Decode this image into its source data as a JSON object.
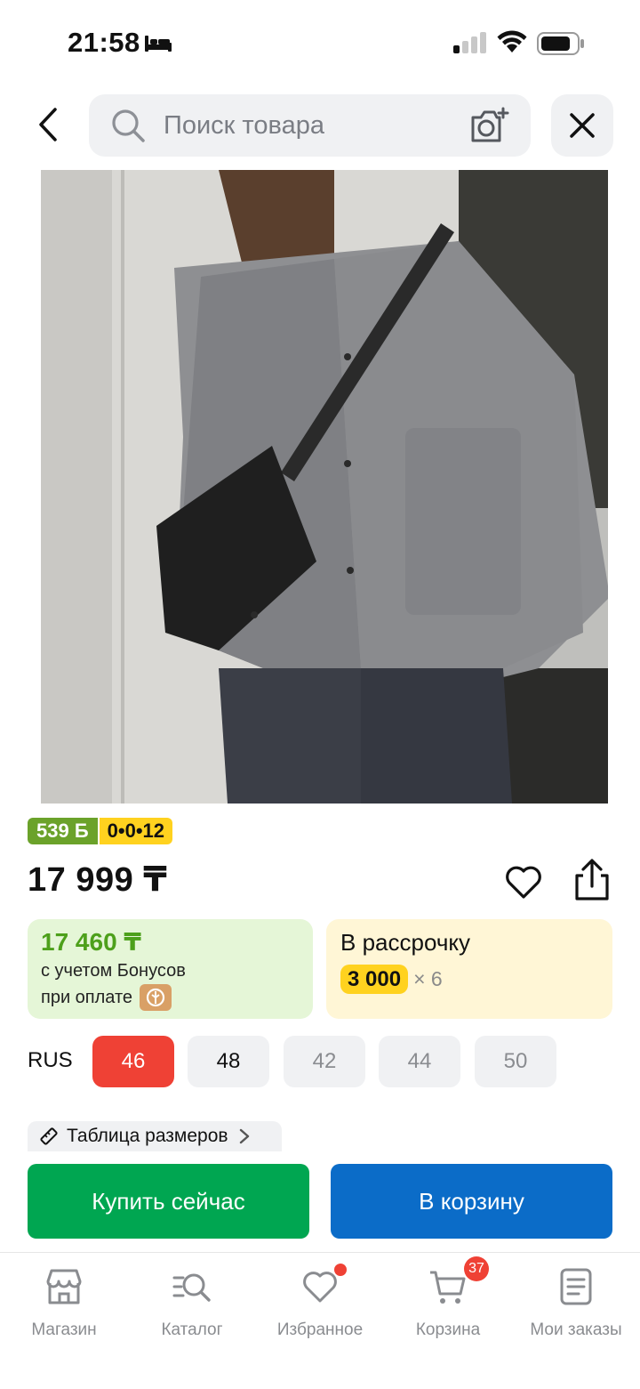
{
  "status_bar": {
    "time": "21:58"
  },
  "search": {
    "placeholder": "Поиск товара"
  },
  "badges": {
    "bonus": "539 Б",
    "installment": "0•0•12"
  },
  "product": {
    "price": "17 999 ₸"
  },
  "bonus_card": {
    "price": "17 460 ₸",
    "line1": "с учетом Бонусов",
    "line2": "при оплате"
  },
  "installment_card": {
    "title": "В рассрочку",
    "amount": "3 000",
    "multiplier": "× 6"
  },
  "sizes": {
    "system": "RUS",
    "options": [
      {
        "label": "46",
        "state": "selected"
      },
      {
        "label": "48",
        "state": "available"
      },
      {
        "label": "42",
        "state": "unavailable"
      },
      {
        "label": "44",
        "state": "unavailable"
      },
      {
        "label": "50",
        "state": "unavailable"
      }
    ]
  },
  "size_chart": {
    "label": "Таблица размеров"
  },
  "actions": {
    "buy_now": "Купить сейчас",
    "add_to_cart": "В корзину"
  },
  "bottom_nav": {
    "items": [
      {
        "label": "Магазин",
        "icon": "store-icon"
      },
      {
        "label": "Каталог",
        "icon": "catalog-search-icon"
      },
      {
        "label": "Избранное",
        "icon": "heart-icon"
      },
      {
        "label": "Корзина",
        "icon": "cart-icon",
        "badge": "37"
      },
      {
        "label": "Мои заказы",
        "icon": "orders-icon"
      }
    ]
  },
  "colors": {
    "accent_green": "#00a651",
    "accent_blue": "#0b6cc8",
    "selected_red": "#ef4135",
    "bonus_green": "#4da01b",
    "yellow": "#ffd21f"
  }
}
